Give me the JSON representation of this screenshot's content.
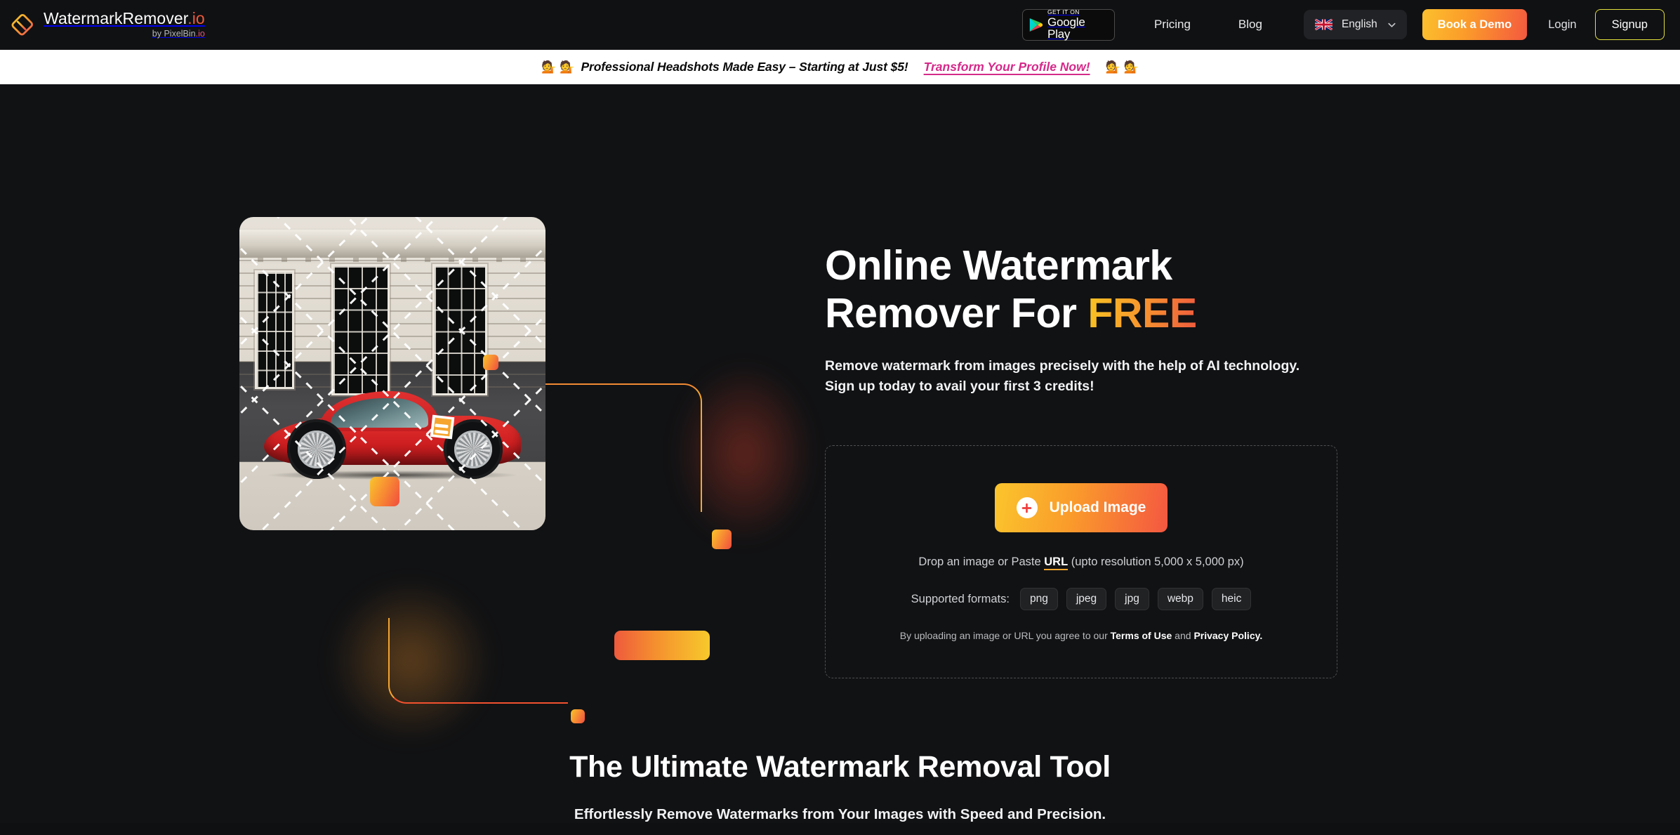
{
  "header": {
    "brand": {
      "logo_icon": "eraser-icon",
      "name": "WatermarkRemover",
      "tld": ".io",
      "byline_prefix": "by PixelBin",
      "byline_tld": ".io"
    },
    "google_play": {
      "icon": "google-play-triangle-icon",
      "top_label": "GET IT ON",
      "bottom_label": "Google Play"
    },
    "nav": [
      {
        "label": "Pricing"
      },
      {
        "label": "Blog"
      }
    ],
    "language": {
      "flag_icon": "uk-flag-icon",
      "selected": "English",
      "chevron_icon": "chevron-down-icon"
    },
    "book_demo_label": "Book a Demo",
    "login_label": "Login",
    "signup_label": "Signup",
    "signup_border_color": "#e4e13c",
    "demo_gradient": [
      "#fcc02e",
      "#f4593f"
    ]
  },
  "promo_banner": {
    "emoji_left": "💁 💁",
    "text": "Professional Headshots Made Easy – Starting at Just $5!",
    "cta": "Transform Your Profile Now!",
    "emoji_right": "💁 💁",
    "background": "#ffffff",
    "cta_color": "#d52a8a"
  },
  "hero": {
    "visual": {
      "photo_alt": "red-sports-car-in-front-of-building-with-watermark",
      "watermark_badge_icon": "eraser-badge-icon",
      "accent_color": "#f6a52f"
    },
    "title_line1": "Online Watermark",
    "title_line2_plain": "Remover For ",
    "title_highlight": "FREE",
    "highlight_gradient": [
      "#f9c323",
      "#ef5b3e"
    ],
    "subtitle": "Remove watermark from images precisely with the help of AI technology. Sign up today to avail your first 3 credits!",
    "upload_card": {
      "button_icon": "plus-icon",
      "button_label": "Upload Image",
      "drop_prefix": "Drop an image or Paste ",
      "drop_url_word": "URL",
      "drop_suffix": " (upto resolution 5,000 x 5,000 px)",
      "formats_label": "Supported formats:",
      "formats": [
        "png",
        "jpeg",
        "jpg",
        "webp",
        "heic"
      ],
      "terms_prefix": "By uploading an image or URL you agree to our ",
      "terms_link": "Terms of Use",
      "terms_middle": " and ",
      "privacy_link": "Privacy Policy.",
      "button_gradient": [
        "#fbc52c",
        "#f45741"
      ]
    }
  },
  "section_two": {
    "title": "The Ultimate Watermark Removal Tool",
    "subtitle": "Effortlessly Remove Watermarks from Your Images with Speed and Precision."
  }
}
